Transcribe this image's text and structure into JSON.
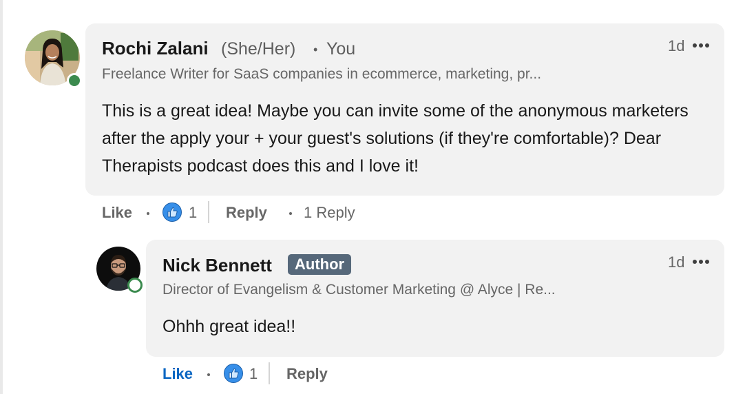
{
  "comments": [
    {
      "author": "Rochi Zalani",
      "pronouns": "(She/Her)",
      "relation": "You",
      "headline": "Freelance Writer for SaaS companies in ecommerce, marketing, pr...",
      "time": "1d",
      "text": "This is a great idea! Maybe you can invite some of the anonymous marketers after the apply your + your guest's solutions (if they're comfortable)? Dear Therapists podcast does this and I love it!",
      "like_label": "Like",
      "reaction_count": "1",
      "reply_label": "Reply",
      "replies_label": "1 Reply"
    }
  ],
  "reply": {
    "author": "Nick Bennett",
    "badge": "Author",
    "headline": "Director of Evangelism & Customer Marketing @ Alyce | Re...",
    "time": "1d",
    "text": "Ohhh great idea!!",
    "like_label": "Like",
    "reaction_count": "1",
    "reply_label": "Reply"
  },
  "colors": {
    "bubble": "#f2f2f2",
    "online": "#3b8a4e",
    "like_blue": "#0a66c2",
    "badge": "#56687a"
  },
  "icons": {
    "reaction": "thumbs-up-icon",
    "more": "more-horizontal-icon"
  }
}
